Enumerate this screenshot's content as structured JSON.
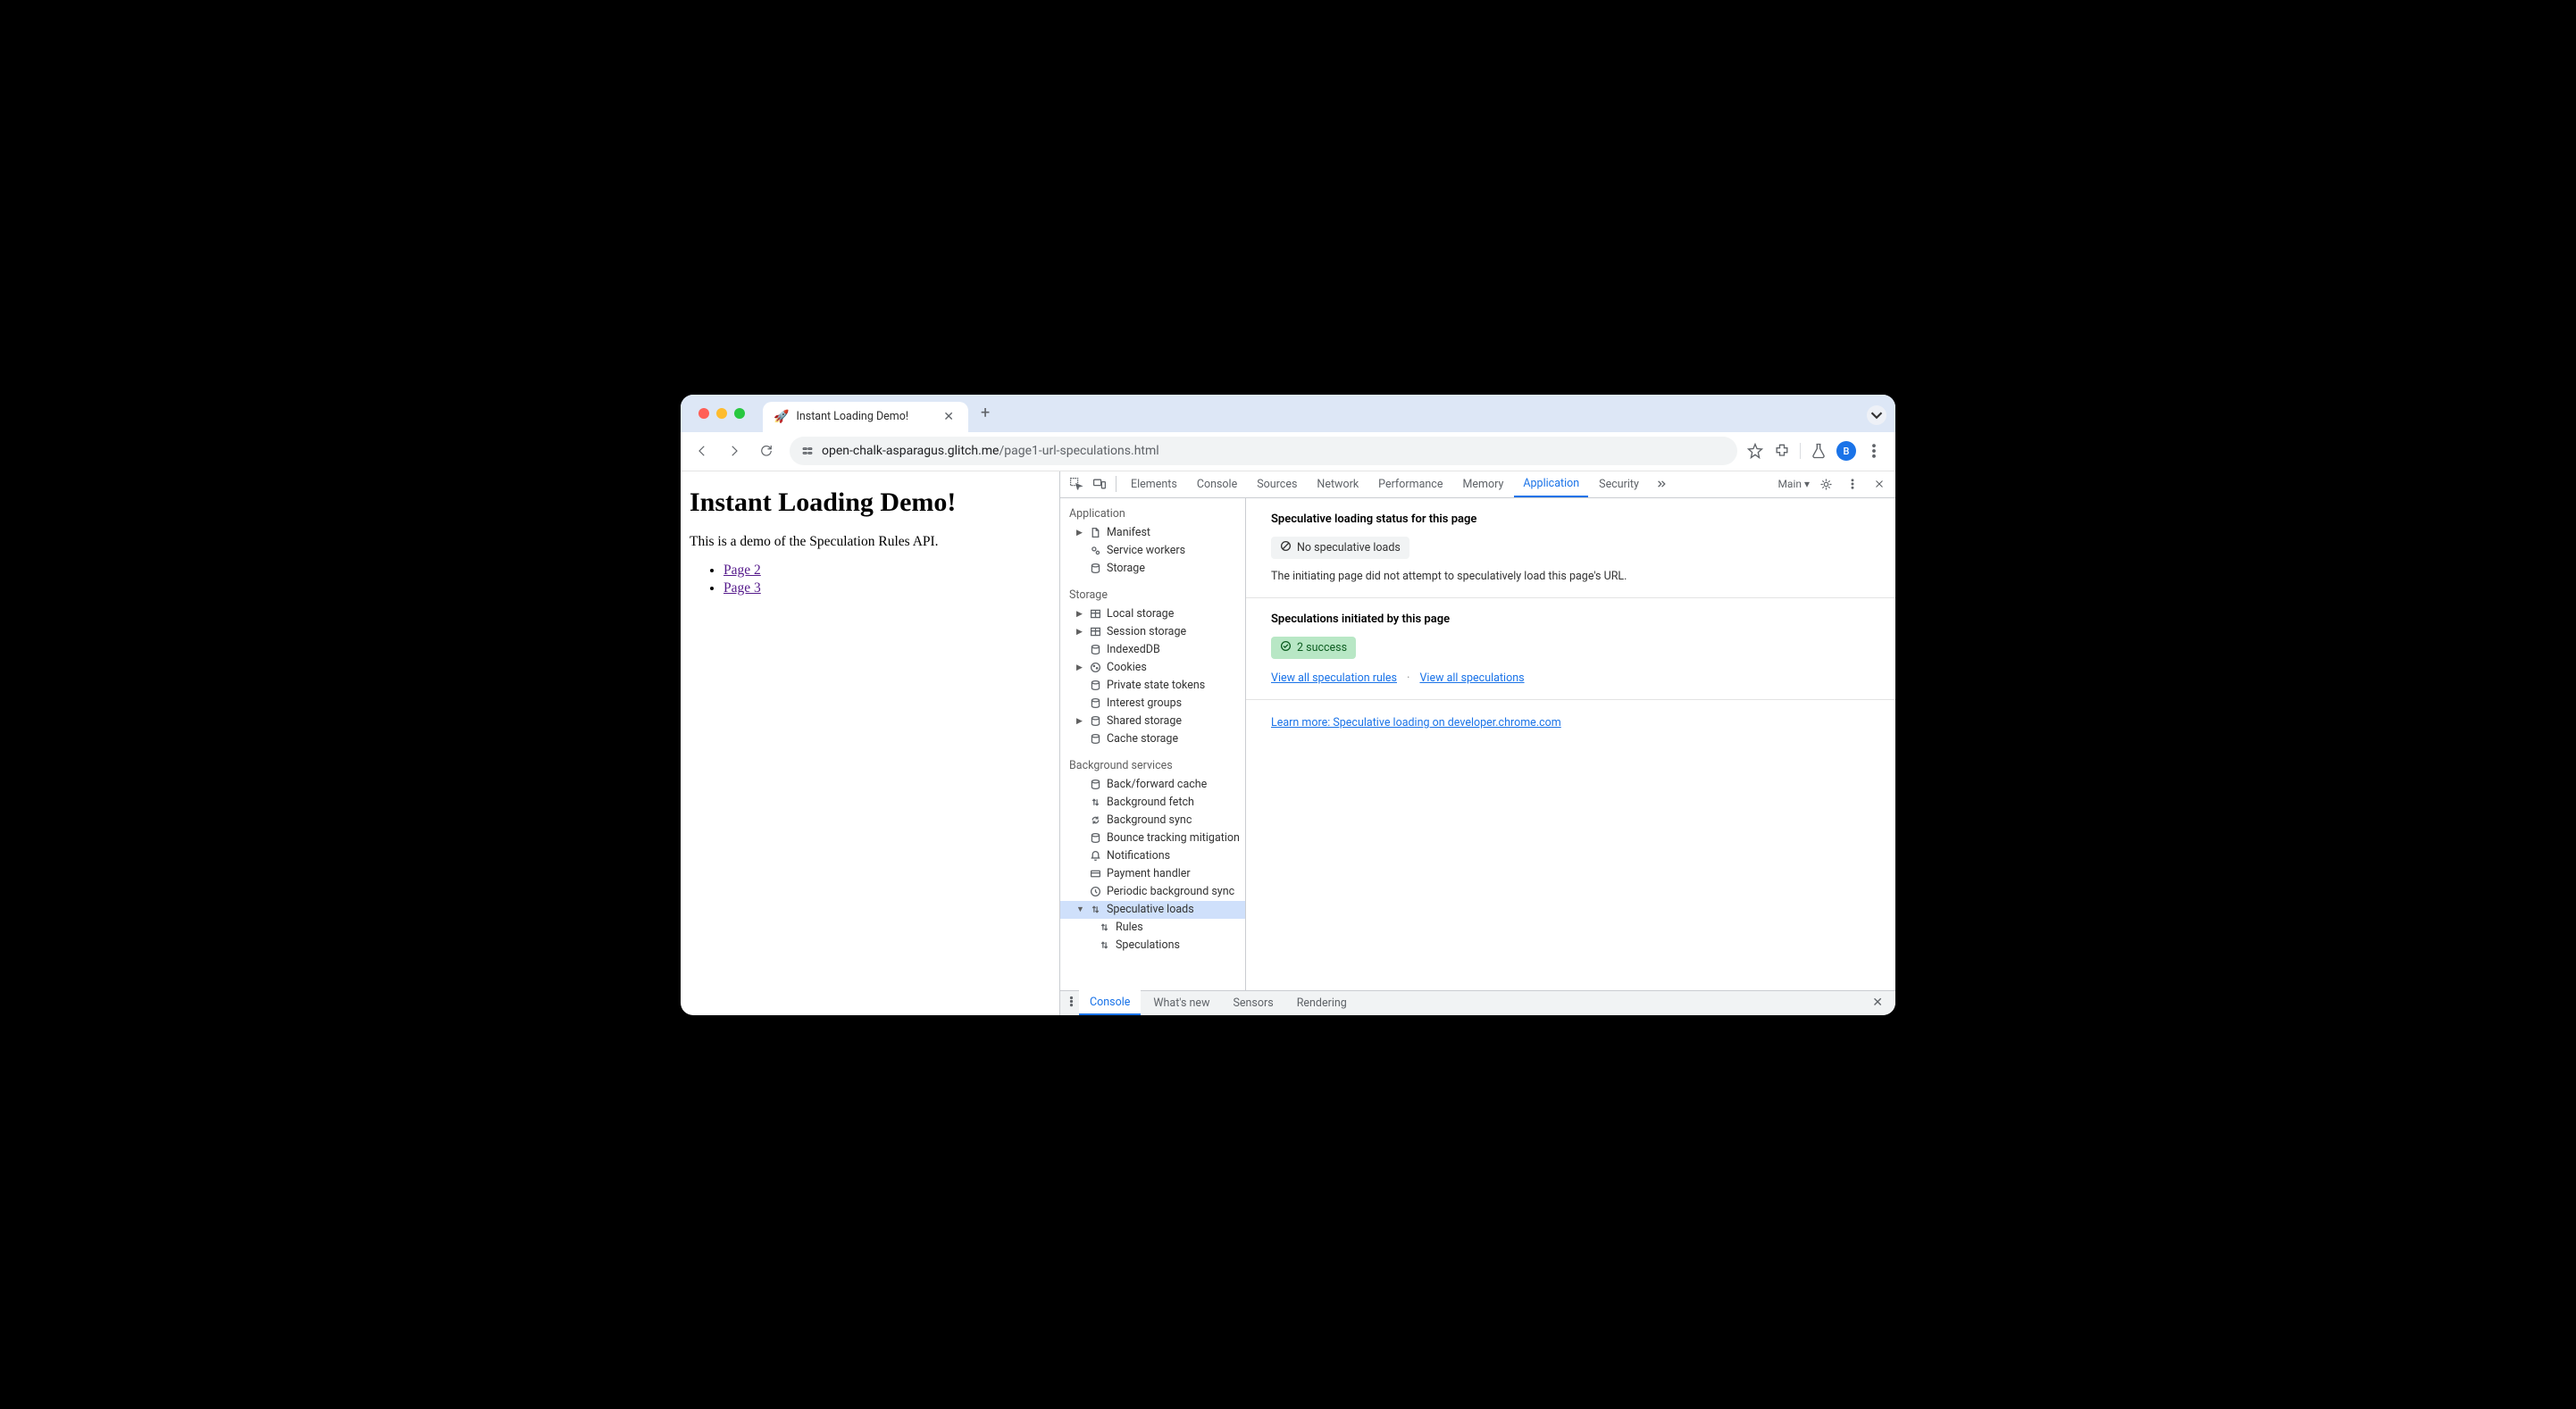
{
  "browser": {
    "tab_title": "Instant Loading Demo!",
    "tab_favicon": "🚀",
    "url_host": "open-chalk-asparagus.glitch.me",
    "url_path": "/page1-url-speculations.html",
    "avatar_letter": "B"
  },
  "page": {
    "heading": "Instant Loading Demo!",
    "intro": "This is a demo of the Speculation Rules API.",
    "links": [
      "Page 2",
      "Page 3"
    ]
  },
  "devtools": {
    "tabs": [
      "Elements",
      "Console",
      "Sources",
      "Network",
      "Performance",
      "Memory",
      "Application",
      "Security"
    ],
    "active_tab": "Application",
    "target_label": "Main",
    "sidebar": {
      "application": {
        "label": "Application",
        "items": [
          {
            "label": "Manifest",
            "icon": "file-icon",
            "arrow": true
          },
          {
            "label": "Service workers",
            "icon": "cogs-icon"
          },
          {
            "label": "Storage",
            "icon": "db-icon"
          }
        ]
      },
      "storage": {
        "label": "Storage",
        "items": [
          {
            "label": "Local storage",
            "icon": "table-icon",
            "arrow": true
          },
          {
            "label": "Session storage",
            "icon": "table-icon",
            "arrow": true
          },
          {
            "label": "IndexedDB",
            "icon": "db-icon"
          },
          {
            "label": "Cookies",
            "icon": "cookie-icon",
            "arrow": true
          },
          {
            "label": "Private state tokens",
            "icon": "db-icon"
          },
          {
            "label": "Interest groups",
            "icon": "db-icon"
          },
          {
            "label": "Shared storage",
            "icon": "db-icon",
            "arrow": true
          },
          {
            "label": "Cache storage",
            "icon": "db-icon"
          }
        ]
      },
      "background": {
        "label": "Background services",
        "items": [
          {
            "label": "Back/forward cache",
            "icon": "db-icon"
          },
          {
            "label": "Background fetch",
            "icon": "updown-icon"
          },
          {
            "label": "Background sync",
            "icon": "sync-icon"
          },
          {
            "label": "Bounce tracking mitigation",
            "icon": "db-icon"
          },
          {
            "label": "Notifications",
            "icon": "bell-icon"
          },
          {
            "label": "Payment handler",
            "icon": "card-icon"
          },
          {
            "label": "Periodic background sync",
            "icon": "clock-icon"
          },
          {
            "label": "Speculative loads",
            "icon": "updown-icon",
            "selected": true,
            "arrow_open": true
          },
          {
            "label": "Rules",
            "icon": "updown-icon",
            "sub": true
          },
          {
            "label": "Speculations",
            "icon": "updown-icon",
            "sub": true
          }
        ]
      }
    },
    "main": {
      "status_heading": "Speculative loading status for this page",
      "status_chip": "No speculative loads",
      "status_desc": "The initiating page did not attempt to speculatively load this page's URL.",
      "initiated_heading": "Speculations initiated by this page",
      "initiated_chip": "2 success",
      "link_rules": "View all speculation rules",
      "link_specs": "View all speculations",
      "learn_more": "Learn more: Speculative loading on developer.chrome.com"
    },
    "drawer": {
      "tabs": [
        "Console",
        "What's new",
        "Sensors",
        "Rendering"
      ],
      "active": "Console"
    }
  }
}
